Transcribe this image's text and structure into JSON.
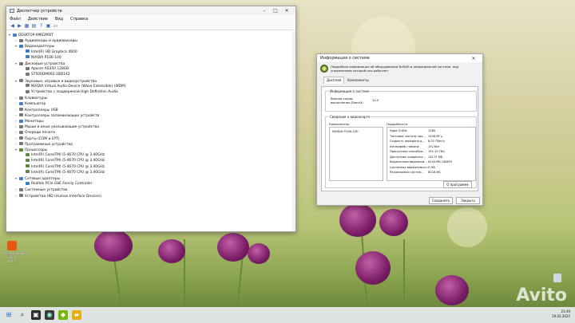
{
  "device_manager": {
    "title": "Диспетчер устройств",
    "menu": [
      "Файл",
      "Действие",
      "Вид",
      "Справка"
    ],
    "tree": [
      {
        "level": 0,
        "expanded": true,
        "label": "DESKTOP-XM62MOT",
        "icon": "computer-icon",
        "color": "#4a7fc1"
      },
      {
        "level": 1,
        "expanded": false,
        "label": "Аудиовходы и аудиовыходы",
        "icon": "audio-icon",
        "color": "#6e6e6e"
      },
      {
        "level": 1,
        "expanded": true,
        "label": "Видеоадаптеры",
        "icon": "display-adapter-icon",
        "color": "#3b7fc4"
      },
      {
        "level": 2,
        "expanded": null,
        "label": "Intel(R) HD Graphics 4600",
        "icon": "display-adapter-icon",
        "color": "#3b7fc4"
      },
      {
        "level": 2,
        "expanded": null,
        "label": "NVIDIA P106-100",
        "icon": "display-adapter-icon",
        "color": "#3b7fc4"
      },
      {
        "level": 1,
        "expanded": true,
        "label": "Дисковые устройства",
        "icon": "disk-icon",
        "color": "#777777"
      },
      {
        "level": 2,
        "expanded": null,
        "label": "Apacer AS350 128GB",
        "icon": "disk-icon",
        "color": "#777777"
      },
      {
        "level": 2,
        "expanded": null,
        "label": "ST500DM002-1BD142",
        "icon": "disk-icon",
        "color": "#777777"
      },
      {
        "level": 1,
        "expanded": true,
        "label": "Звуковые, игровые и видеоустройства",
        "icon": "sound-icon",
        "color": "#777777"
      },
      {
        "level": 2,
        "expanded": null,
        "label": "NVIDIA Virtual Audio Device (Wave Extensible) (WDM)",
        "icon": "sound-icon",
        "color": "#777777"
      },
      {
        "level": 2,
        "expanded": null,
        "label": "Устройство с поддержкой High Definition Audio",
        "icon": "sound-icon",
        "color": "#777777"
      },
      {
        "level": 1,
        "expanded": false,
        "label": "Клавиатуры",
        "icon": "keyboard-icon",
        "color": "#777777"
      },
      {
        "level": 1,
        "expanded": false,
        "label": "Компьютер",
        "icon": "computer-icon",
        "color": "#4a7fc1"
      },
      {
        "level": 1,
        "expanded": false,
        "label": "Контроллеры USB",
        "icon": "usb-icon",
        "color": "#777777"
      },
      {
        "level": 1,
        "expanded": false,
        "label": "Контроллеры запоминающих устройств",
        "icon": "storage-icon",
        "color": "#777777"
      },
      {
        "level": 1,
        "expanded": false,
        "label": "Мониторы",
        "icon": "monitor-icon",
        "color": "#3b7fc4"
      },
      {
        "level": 1,
        "expanded": false,
        "label": "Мыши и иные указывающие устройства",
        "icon": "mouse-icon",
        "color": "#777777"
      },
      {
        "level": 1,
        "expanded": false,
        "label": "Очереди печати",
        "icon": "printer-icon",
        "color": "#777777"
      },
      {
        "level": 1,
        "expanded": false,
        "label": "Порты (COM и LPT)",
        "icon": "port-icon",
        "color": "#777777"
      },
      {
        "level": 1,
        "expanded": false,
        "label": "Программные устройства",
        "icon": "software-device-icon",
        "color": "#777777"
      },
      {
        "level": 1,
        "expanded": true,
        "label": "Процессоры",
        "icon": "cpu-icon",
        "color": "#5c8a3a"
      },
      {
        "level": 2,
        "expanded": null,
        "label": "Intel(R) Core(TM) i5-4670 CPU @ 3.40GHz",
        "icon": "cpu-icon",
        "color": "#5c8a3a"
      },
      {
        "level": 2,
        "expanded": null,
        "label": "Intel(R) Core(TM) i5-4670 CPU @ 3.40GHz",
        "icon": "cpu-icon",
        "color": "#5c8a3a"
      },
      {
        "level": 2,
        "expanded": null,
        "label": "Intel(R) Core(TM) i5-4670 CPU @ 3.40GHz",
        "icon": "cpu-icon",
        "color": "#5c8a3a"
      },
      {
        "level": 2,
        "expanded": null,
        "label": "Intel(R) Core(TM) i5-4670 CPU @ 3.40GHz",
        "icon": "cpu-icon",
        "color": "#5c8a3a"
      },
      {
        "level": 1,
        "expanded": true,
        "label": "Сетевые адаптеры",
        "icon": "network-icon",
        "color": "#3b7fc4"
      },
      {
        "level": 2,
        "expanded": null,
        "label": "Realtek PCIe GbE Family Controller",
        "icon": "network-icon",
        "color": "#3b7fc4"
      },
      {
        "level": 1,
        "expanded": false,
        "label": "Системные устройства",
        "icon": "system-icon",
        "color": "#777777"
      },
      {
        "level": 1,
        "expanded": false,
        "label": "Устройства HID (Human Interface Devices)",
        "icon": "hid-icon",
        "color": "#777777"
      }
    ]
  },
  "dxdiag": {
    "title": "Информация о системе",
    "header_text": "Подробная информация об оборудовании NVIDIA и операционной системе, под управлением которой оно работает.",
    "tabs": [
      "Дисплей",
      "Компоненты"
    ],
    "system_group": "Информация о системе",
    "directx_label": "Версия среды выполнения DirectX:",
    "directx_value": "12.0",
    "graphics_group": "Сведения о видеокарте",
    "col_components": "Компоненты",
    "col_details": "Подробности",
    "component": "NVIDIA P106-100",
    "properties": [
      {
        "name": "Ядра CUDA:",
        "value": "1280"
      },
      {
        "name": "Тактовая частота про...",
        "value": "1506 МГц"
      },
      {
        "name": "Скорость передачи д...",
        "value": "8.01 Гбит/с"
      },
      {
        "name": "Интерфейс памяти:",
        "value": "192 бит"
      },
      {
        "name": "Пропускная способно...",
        "value": "192.19 Гб/с"
      },
      {
        "name": "Доступная графическ...",
        "value": "14172 МБ"
      },
      {
        "name": "Выделенная видеопам...",
        "value": "6144 МБ GDDR5"
      },
      {
        "name": "Системная видеопамять:",
        "value": "0 МБ"
      },
      {
        "name": "Разделяемая систем...",
        "value": "8028 МБ"
      }
    ],
    "about_button": "О программе",
    "save_button": "Сохранить",
    "close_button": "Закрыть"
  },
  "desktop_icon_label": "Всплывающие Grind Ste...",
  "tray": {
    "time": "23:49",
    "date": "19.02.2025"
  },
  "watermark": "Avito"
}
